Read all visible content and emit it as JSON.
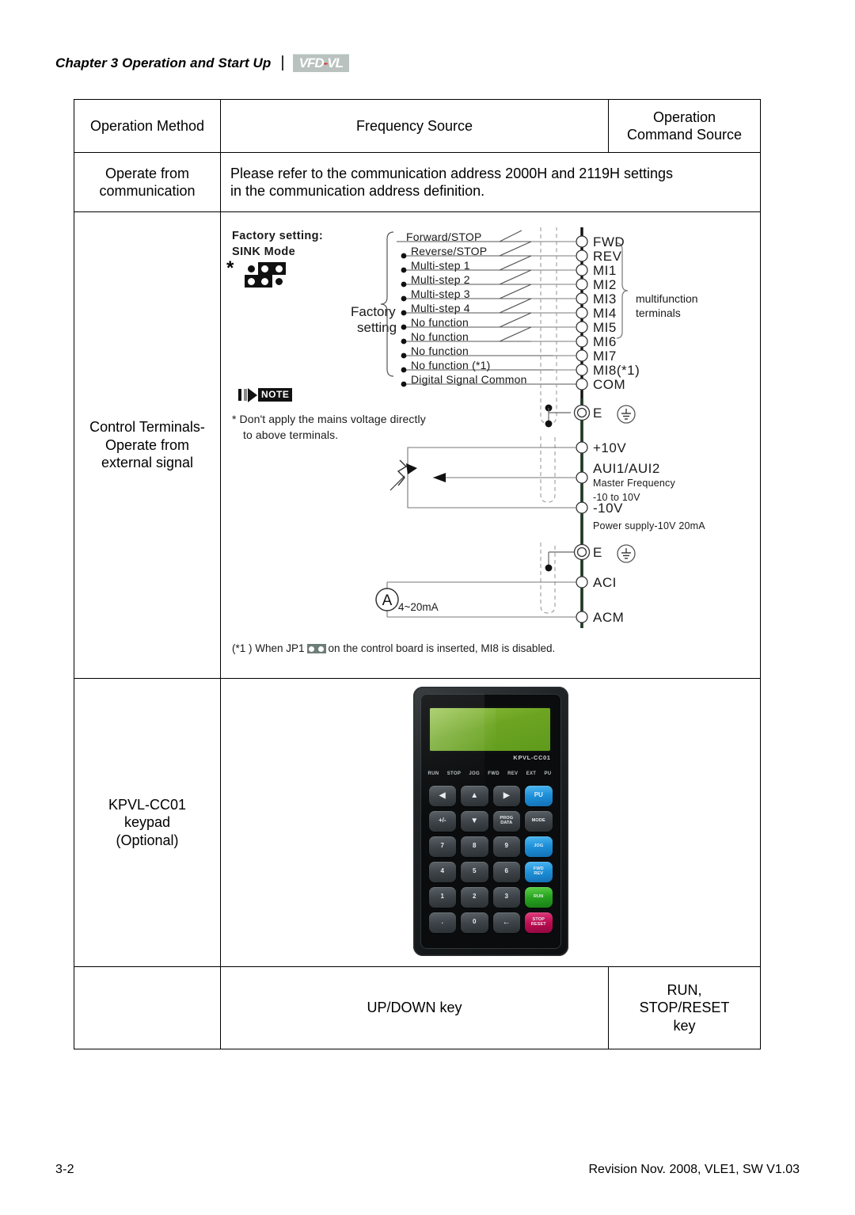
{
  "header": {
    "chapter": "Chapter 3 Operation and Start Up",
    "separator": "|",
    "logo_text": "VFD",
    "logo_dash": "-",
    "logo_text2": "VL"
  },
  "table": {
    "columns": [
      "Operation Method",
      "Frequency Source",
      "Operation Command Source"
    ],
    "col_head_1": "Operation Method",
    "col_head_2": "Frequency Source",
    "col_head_3_line1": "Operation",
    "col_head_3_line2": "Command Source",
    "rows": [
      {
        "method_line1": "Operate from",
        "method_line2": "communication",
        "body_line1": "Please refer to the communication address 2000H and 2119H settings",
        "body_line2": "in the communication address definition."
      },
      {
        "method_line1": "Control Terminals-",
        "method_line2": "Operate from",
        "method_line3": "external signal"
      },
      {
        "method_line1": "KPVL-CC01",
        "method_line2": "keypad",
        "method_line3": "(Optional)"
      }
    ],
    "bottom_row": {
      "updown_key": "UP/DOWN key",
      "run_key_line1": "RUN,",
      "run_key_line2": "STOP/RESET",
      "run_key_line3": "key"
    }
  },
  "diagram": {
    "factory_setting_title_line1": "Factory setting:",
    "factory_setting_title_line2": "SINK Mode",
    "star": "*",
    "dip_switch": {
      "states": [
        "on",
        "off",
        "off",
        "off",
        "off",
        "on"
      ]
    },
    "note_badge_label": "NOTE",
    "note_line1": "* Don't apply the mains voltage directly",
    "note_line2": "to above terminals.",
    "factory_brace_line1": "Factory",
    "factory_brace_line2": "setting",
    "signal_labels": [
      "Forward/STOP",
      "Reverse/STOP",
      "Multi-step 1",
      "Multi-step 2",
      "Multi-step 3",
      "Multi-step 4",
      "No function",
      "No function",
      "No function",
      "No function (*1)",
      "Digital Signal Common"
    ],
    "terminal_labels": [
      "FWD",
      "REV",
      "MI1",
      "MI2",
      "MI3",
      "MI4",
      "MI5",
      "MI6",
      "MI7",
      "MI8(*1)",
      "COM"
    ],
    "multifunction_line1": "multifunction",
    "multifunction_line2": "terminals",
    "analog": {
      "e1": "E",
      "plus10v": "+10V",
      "aui": "AUI1/AUI2",
      "aui_sub1": "Master Frequency",
      "aui_sub2": "-10 to 10V",
      "minus10v": "-10V",
      "power_supply": "Power supply-10V 20mA",
      "e2": "E",
      "aci": "ACI",
      "acm": "ACM",
      "ammeter_letter": "A",
      "ammeter_range": "4~20mA"
    },
    "footnote_pre": "(*1 ) When JP1",
    "footnote_post": "on the control board is inserted, MI8 is disabled."
  },
  "keypad": {
    "model": "KPVL-CC01",
    "status_leds": [
      "RUN",
      "STOP",
      "JOG",
      "FWD",
      "REV",
      "EXT",
      "PU"
    ],
    "keys": [
      {
        "label": "◀",
        "type": "glyph",
        "color": "gray"
      },
      {
        "label": "▲",
        "type": "glyph",
        "color": "gray"
      },
      {
        "label": "▶",
        "type": "glyph",
        "color": "gray"
      },
      {
        "label": "PU",
        "type": "text",
        "color": "blue"
      },
      {
        "label": "+/-",
        "type": "text",
        "color": "gray"
      },
      {
        "label": "▼",
        "type": "glyph",
        "color": "gray"
      },
      {
        "label": "PROG\nDATA",
        "type": "tiny",
        "color": "gray"
      },
      {
        "label": "MODE",
        "type": "tiny",
        "color": "gray"
      },
      {
        "label": "7",
        "type": "text",
        "color": "gray"
      },
      {
        "label": "8",
        "type": "text",
        "color": "gray"
      },
      {
        "label": "9",
        "type": "text",
        "color": "gray"
      },
      {
        "label": "JOG",
        "type": "tiny",
        "color": "blue"
      },
      {
        "label": "4",
        "type": "text",
        "color": "gray"
      },
      {
        "label": "5",
        "type": "text",
        "color": "gray"
      },
      {
        "label": "6",
        "type": "text",
        "color": "gray"
      },
      {
        "label": "FWD\nREV",
        "type": "tiny",
        "color": "blue"
      },
      {
        "label": "1",
        "type": "text",
        "color": "gray"
      },
      {
        "label": "2",
        "type": "text",
        "color": "gray"
      },
      {
        "label": "3",
        "type": "text",
        "color": "gray"
      },
      {
        "label": "RUN",
        "type": "tiny",
        "color": "green"
      },
      {
        "label": ".",
        "type": "text",
        "color": "gray"
      },
      {
        "label": "0",
        "type": "text",
        "color": "gray"
      },
      {
        "label": "←",
        "type": "glyph",
        "color": "gray"
      },
      {
        "label": "STOP\nRESET",
        "type": "tiny",
        "color": "red"
      }
    ]
  },
  "footer": {
    "page": "3-2",
    "revision": "Revision Nov. 2008, VLE1, SW V1.03"
  }
}
